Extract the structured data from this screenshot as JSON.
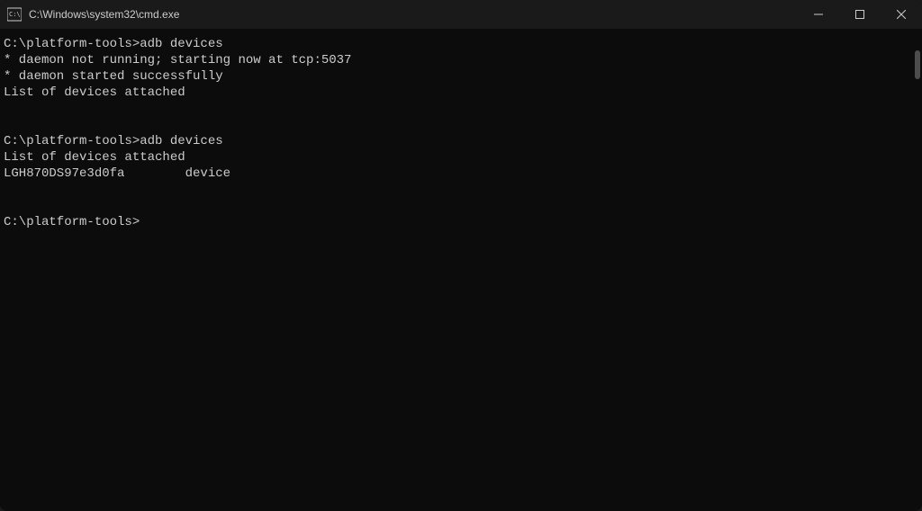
{
  "titlebar": {
    "title": "C:\\Windows\\system32\\cmd.exe"
  },
  "terminal": {
    "lines": [
      "C:\\platform-tools>adb devices",
      "* daemon not running; starting now at tcp:5037",
      "* daemon started successfully",
      "List of devices attached",
      "",
      "",
      "C:\\platform-tools>adb devices",
      "List of devices attached",
      "LGH870DS97e3d0fa        device",
      "",
      "",
      "C:\\platform-tools>"
    ]
  }
}
